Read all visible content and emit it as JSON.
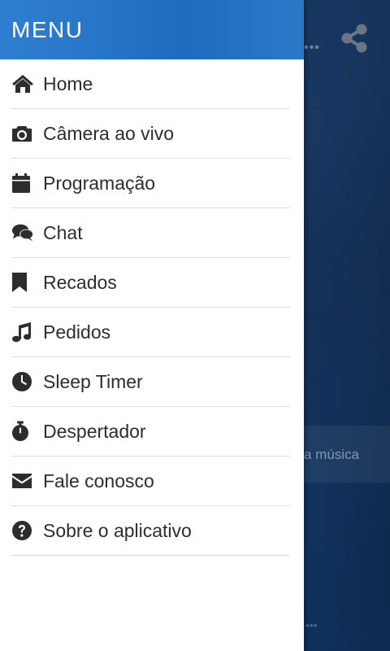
{
  "drawer": {
    "title": "MENU",
    "items": [
      {
        "label": "Home",
        "icon": "home-icon"
      },
      {
        "label": "Câmera ao vivo",
        "icon": "camera-icon"
      },
      {
        "label": "Programação",
        "icon": "calendar-icon"
      },
      {
        "label": "Chat",
        "icon": "comments-icon"
      },
      {
        "label": "Recados",
        "icon": "bookmark-icon"
      },
      {
        "label": "Pedidos",
        "icon": "music-icon"
      },
      {
        "label": "Sleep Timer",
        "icon": "clock-icon"
      },
      {
        "label": "Despertador",
        "icon": "stopwatch-icon"
      },
      {
        "label": "Fale conosco",
        "icon": "envelope-icon"
      },
      {
        "label": "Sobre o aplicativo",
        "icon": "question-circle-icon"
      }
    ]
  },
  "background": {
    "partial_text": "a música",
    "share_icon": "share-icon"
  },
  "colors": {
    "header_blue": "#1f6cc0",
    "icon_dark": "#2d2d2d",
    "divider": "#dcdcdc"
  }
}
